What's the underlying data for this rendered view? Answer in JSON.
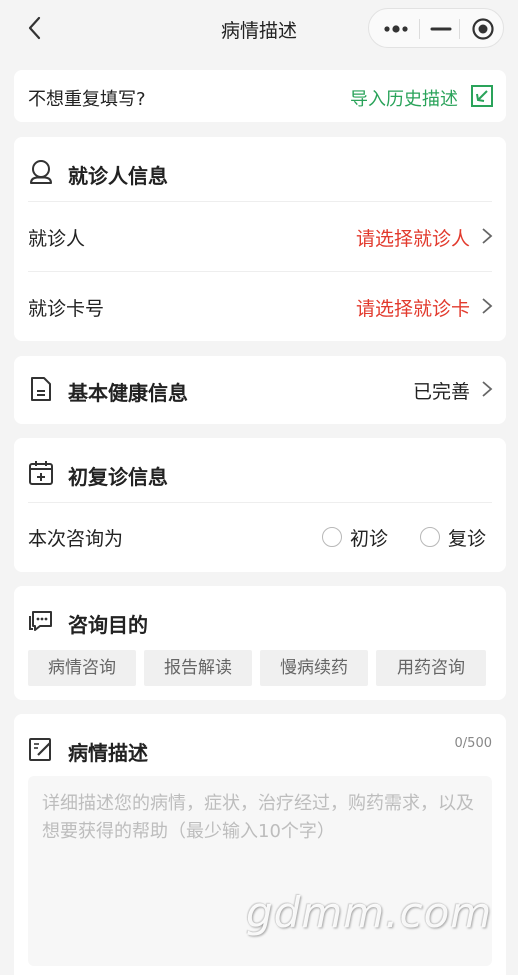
{
  "navbar": {
    "title": "病情描述"
  },
  "import": {
    "question": "不想重复填写?",
    "link": "导入历史描述"
  },
  "patient": {
    "title": "就诊人信息",
    "rows": [
      {
        "label": "就诊人",
        "value": "请选择就诊人"
      },
      {
        "label": "就诊卡号",
        "value": "请选择就诊卡"
      }
    ]
  },
  "health": {
    "title": "基本健康信息",
    "status": "已完善"
  },
  "visit": {
    "title": "初复诊信息",
    "question": "本次咨询为",
    "options": [
      "初诊",
      "复诊"
    ]
  },
  "purpose": {
    "title": "咨询目的",
    "tags": [
      "病情咨询",
      "报告解读",
      "慢病续药",
      "用药咨询"
    ]
  },
  "description": {
    "title": "病情描述",
    "counter": "0/500",
    "placeholder": "详细描述您的病情，症状，治疗经过，购药需求，以及想要获得的帮助（最少输入10个字）"
  },
  "watermark": "gdmm.com",
  "colors": {
    "accent_green": "#2aa35a",
    "warning_red": "#e23a2d",
    "background": "#f4f4f4"
  }
}
